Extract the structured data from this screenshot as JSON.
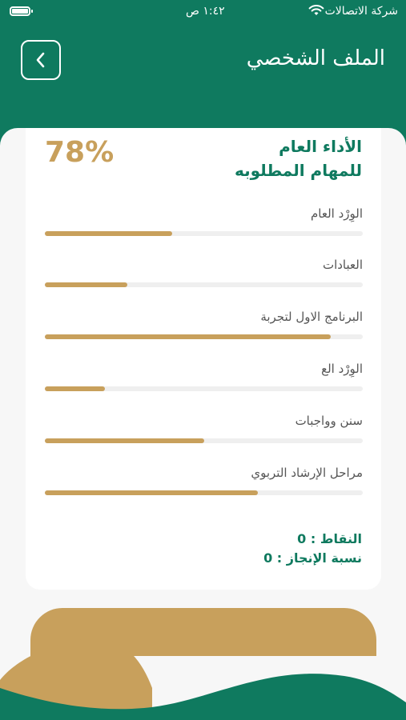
{
  "status_bar": {
    "carrier": "شركة الاتصالات",
    "time": "١:٤٢ ص"
  },
  "header": {
    "title": "الملف الشخصي",
    "back_icon": "chevron-left-icon"
  },
  "card": {
    "percent": "78%",
    "title_line1": "الأداء العام",
    "title_line2": "للمهام المطلوبه",
    "metrics": [
      {
        "label": "الوِرْد العام",
        "progress": 0.4
      },
      {
        "label": "العبادات",
        "progress": 0.26
      },
      {
        "label": "البرنامج الاول لتجربة",
        "progress": 0.9
      },
      {
        "label": "الوِرْد الع",
        "progress": 0.19
      },
      {
        "label": "سنن وواجبات",
        "progress": 0.5
      },
      {
        "label": "مراحل الإرشاد التربوي",
        "progress": 0.67
      }
    ],
    "points_text": "النقاط : 0",
    "completion_text": "نسبة الإنجاز : 0"
  },
  "colors": {
    "primary": "#0f7a5f",
    "accent": "#c8a05c"
  }
}
